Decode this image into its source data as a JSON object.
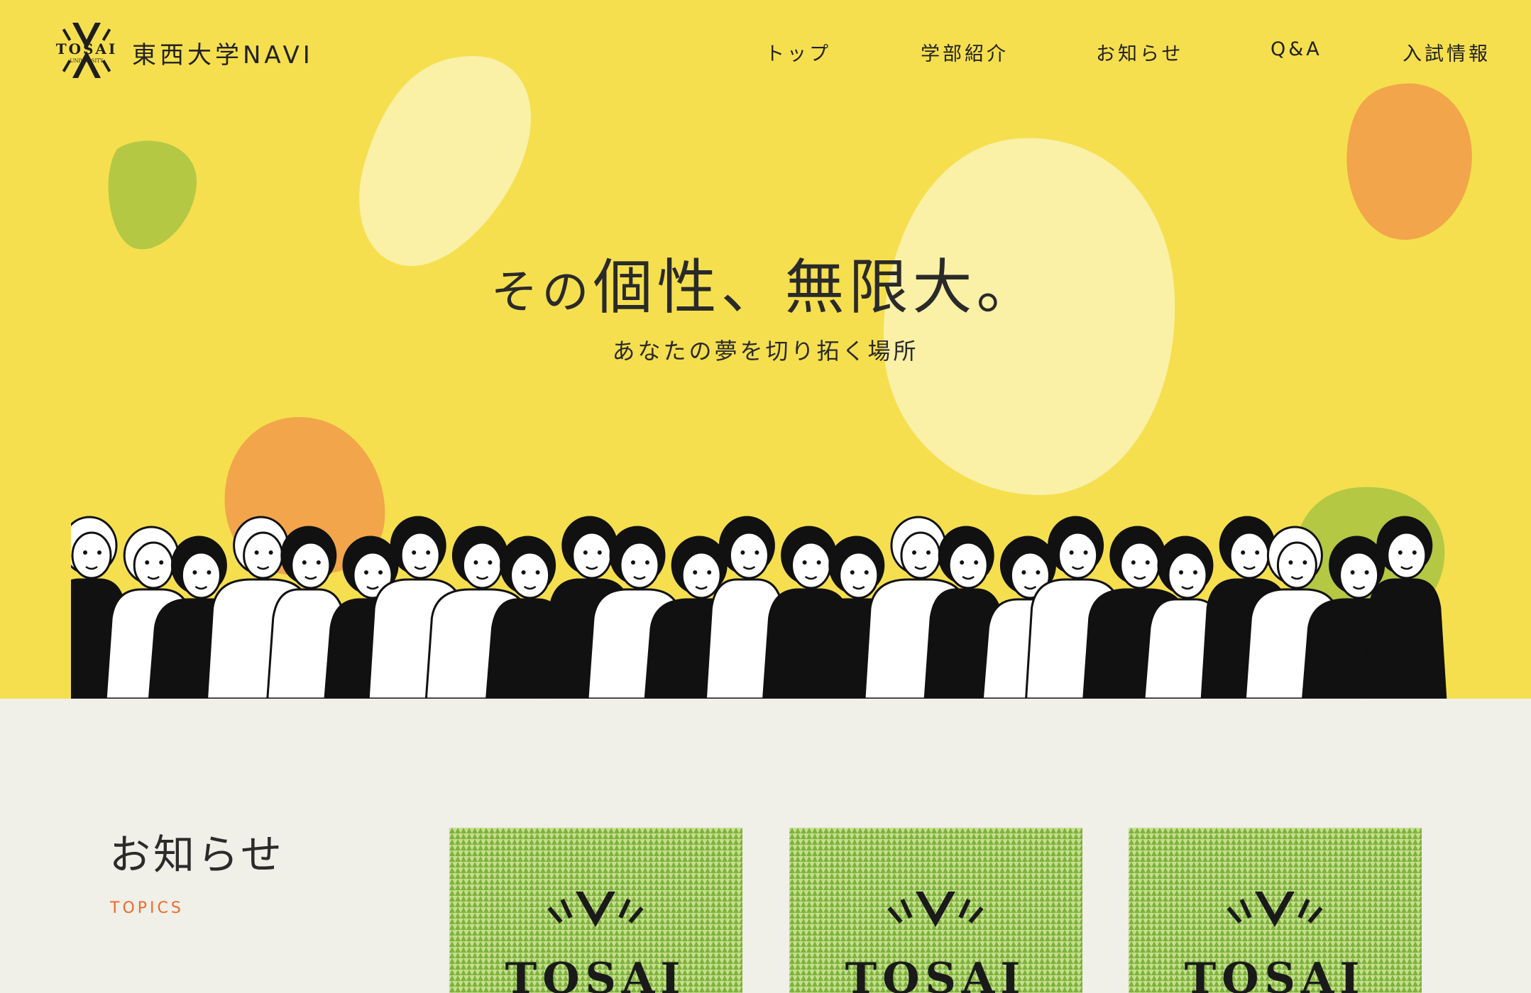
{
  "header": {
    "logo_text": "TOSAI",
    "logo_sub": "UNIVERSITY",
    "site_name": "東西大学NAVI"
  },
  "nav": {
    "items": [
      {
        "label": "トップ"
      },
      {
        "label": "学部紹介"
      },
      {
        "label": "お知らせ"
      },
      {
        "label": "Q&A"
      },
      {
        "label": "入試情報"
      }
    ]
  },
  "hero": {
    "headline_prefix": "その",
    "headline_main": "個性、無限大。",
    "subline": "あなたの夢を切り拓く場所"
  },
  "topics": {
    "title": "お知らせ",
    "subtitle": "TOPICS",
    "cards": [
      {
        "logo_text": "TOSAI"
      },
      {
        "logo_text": "TOSAI"
      },
      {
        "logo_text": "TOSAI"
      }
    ]
  },
  "colors": {
    "hero_bg": "#f5df4e",
    "section_bg": "#f0efe8",
    "accent_orange": "#f2a54a",
    "accent_green": "#b5c843",
    "accent_cream": "#faf0a6",
    "topics_sub": "#ee6a2a",
    "card_green": "#8fc14a"
  }
}
